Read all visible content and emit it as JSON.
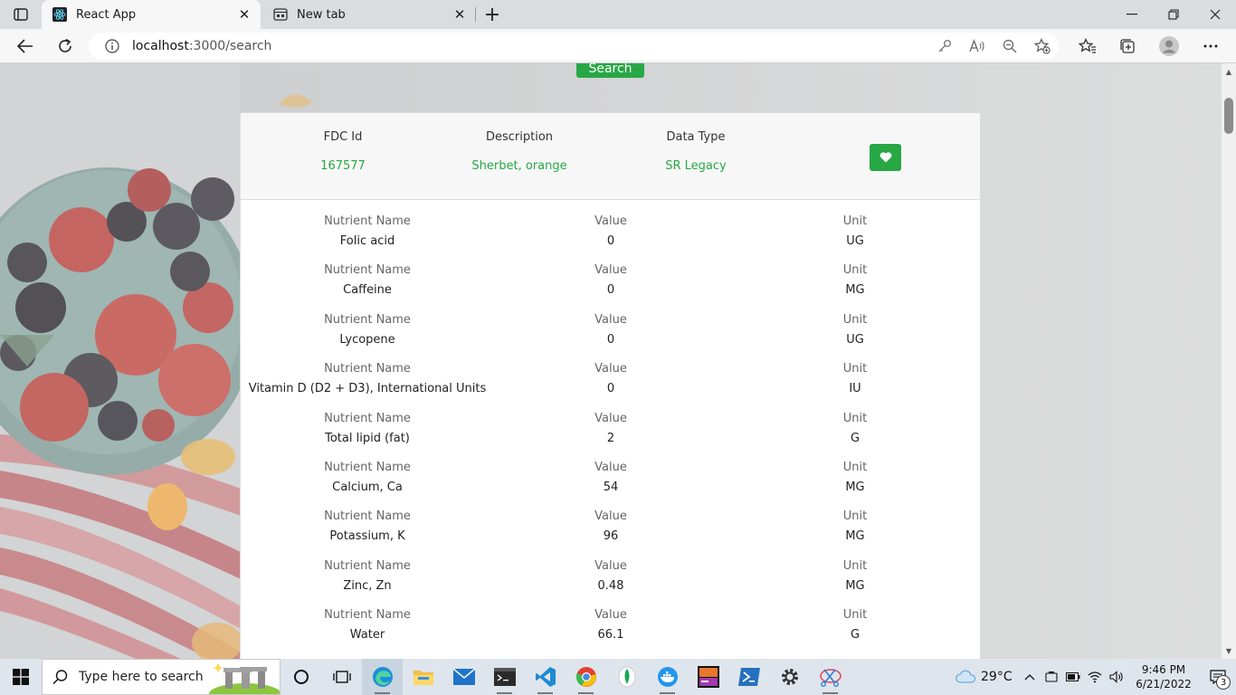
{
  "browser": {
    "tabs": [
      {
        "title": "React App",
        "active": true
      },
      {
        "title": "New tab",
        "active": false
      }
    ],
    "address": {
      "host": "localhost",
      "path": ":3000/search"
    }
  },
  "page": {
    "search_button": "Search",
    "food": {
      "headers": {
        "fdc_id": "FDC Id",
        "description": "Description",
        "data_type": "Data Type"
      },
      "fdc_id": "167577",
      "description": "Sherbet, orange",
      "data_type": "SR Legacy"
    },
    "nutrient_headers": {
      "name": "Nutrient Name",
      "value": "Value",
      "unit": "Unit"
    },
    "nutrients": [
      {
        "name": "Folic acid",
        "value": "0",
        "unit": "UG"
      },
      {
        "name": "Caffeine",
        "value": "0",
        "unit": "MG"
      },
      {
        "name": "Lycopene",
        "value": "0",
        "unit": "UG"
      },
      {
        "name": "Vitamin D (D2 + D3), International Units",
        "value": "0",
        "unit": "IU"
      },
      {
        "name": "Total lipid (fat)",
        "value": "2",
        "unit": "G"
      },
      {
        "name": "Calcium, Ca",
        "value": "54",
        "unit": "MG"
      },
      {
        "name": "Potassium, K",
        "value": "96",
        "unit": "MG"
      },
      {
        "name": "Zinc, Zn",
        "value": "0.48",
        "unit": "MG"
      },
      {
        "name": "Water",
        "value": "66.1",
        "unit": "G"
      }
    ]
  },
  "taskbar": {
    "search_placeholder": "Type here to search",
    "weather": "29°C",
    "time": "9:46 PM",
    "date": "6/21/2022",
    "notification_count": "3"
  },
  "colors": {
    "accent_green": "#28a745"
  }
}
